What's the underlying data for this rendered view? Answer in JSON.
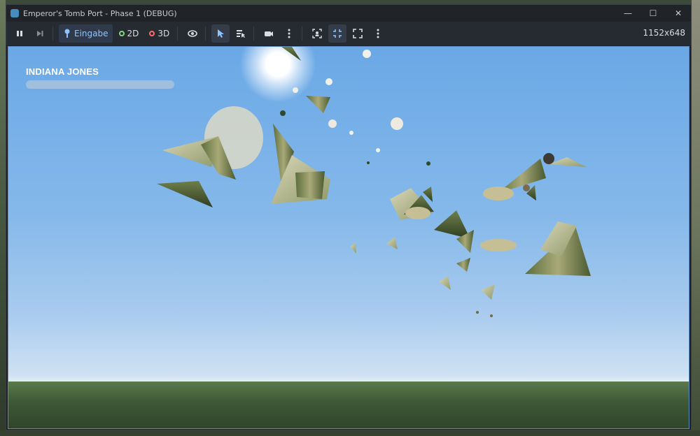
{
  "window": {
    "title": "Emperor's Tomb Port - Phase 1 (DEBUG)",
    "controls": {
      "minimize": "—",
      "maximize": "☐",
      "close": "✕"
    }
  },
  "toolbar": {
    "input_label": "Eingabe",
    "mode_2d_label": "2D",
    "mode_3d_label": "3D",
    "resolution": "1152x648"
  },
  "hud": {
    "player_name": "INDIANA JONES",
    "health_fraction": 0
  },
  "colors": {
    "sky_top": "#6aa8e6",
    "ground": "#3f5a37",
    "mode_2d": "#7fd67f",
    "mode_3d": "#ff6b6b",
    "accent": "#8fc3ff"
  }
}
